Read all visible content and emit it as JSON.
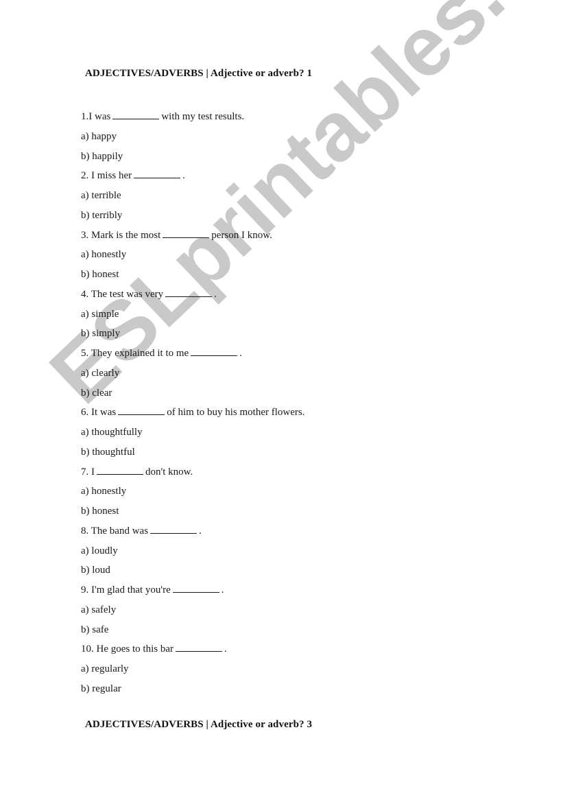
{
  "document": {
    "heading_top": "ADJECTIVES/ADVERBS | Adjective or adverb? 1",
    "heading_bottom": "ADJECTIVES/ADVERBS | Adjective or adverb? 3",
    "watermark": "ESLprintables.com",
    "watermark_color": "#c9c9c9",
    "blank": "________",
    "questions": [
      {
        "number": "1.",
        "before": "I was",
        "after": "with my test results.",
        "options": [
          "a) happy",
          "b) happily"
        ]
      },
      {
        "number": "2.",
        "before": " I miss her",
        "after": ".",
        "options": [
          "a) terrible",
          "b) terribly"
        ]
      },
      {
        "number": "3.",
        "before": " Mark is the most",
        "after": "person I know.",
        "options": [
          "a) honestly",
          "b) honest"
        ]
      },
      {
        "number": "4.",
        "before": " The test was very",
        "after": ".",
        "options": [
          "a) simple",
          "b) simply"
        ]
      },
      {
        "number": "5.",
        "before": " They explained it to me",
        "after": ".",
        "options": [
          "a) clearly",
          "b) clear"
        ]
      },
      {
        "number": "6.",
        "before": " It was",
        "after": "of him to buy his mother flowers.",
        "options": [
          "a) thoughtfully",
          "b) thoughtful"
        ]
      },
      {
        "number": "7.",
        "before": " I",
        "after": "don't know.",
        "options": [
          "a) honestly",
          "b) honest"
        ]
      },
      {
        "number": "8.",
        "before": " The band was",
        "after": ".",
        "options": [
          "a) loudly",
          "b) loud"
        ]
      },
      {
        "number": "9.",
        "before": " I'm glad that you're",
        "after": ".",
        "options": [
          "a) safely",
          "b) safe"
        ]
      },
      {
        "number": "10.",
        "before": " He goes to this bar",
        "after": ".",
        "options": [
          "a) regularly",
          "b) regular"
        ]
      }
    ]
  }
}
